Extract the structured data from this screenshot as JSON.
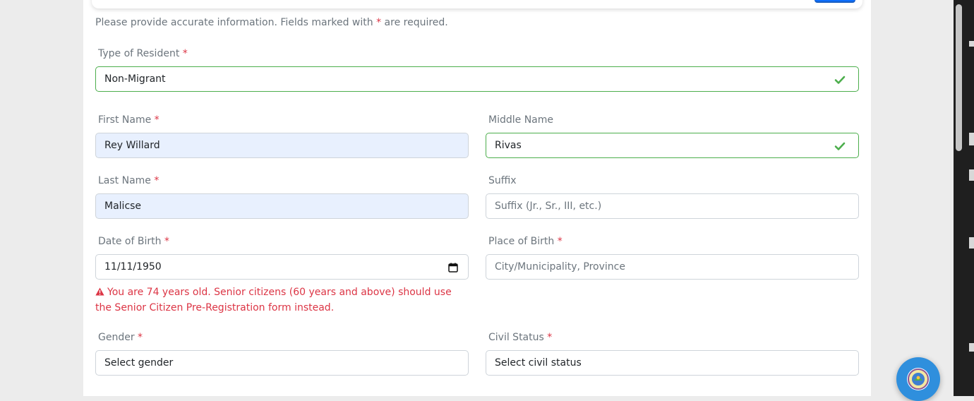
{
  "form": {
    "intro_prefix": "Please provide accurate information. Fields marked with",
    "intro_star": "*",
    "intro_suffix": "are required.",
    "required_mark": "*",
    "resident_type": {
      "label": "Type of Resident",
      "value": "Non-Migrant"
    },
    "first_name": {
      "label": "First Name",
      "value": "Rey Willard"
    },
    "middle_name": {
      "label": "Middle Name",
      "value": "Rivas"
    },
    "last_name": {
      "label": "Last Name",
      "value": "Malicse"
    },
    "suffix": {
      "label": "Suffix",
      "placeholder": "Suffix (Jr., Sr., III, etc.)"
    },
    "date_of_birth": {
      "label": "Date of Birth",
      "value": "11/11/1950"
    },
    "place_of_birth": {
      "label": "Place of Birth",
      "placeholder": "City/Municipality, Province"
    },
    "age_warning": "You are 74 years old. Senior citizens (60 years and above) should use the Senior Citizen Pre-Registration form instead.",
    "gender": {
      "label": "Gender",
      "value": "Select gender"
    },
    "civil_status": {
      "label": "Civil Status",
      "value": "Select civil status"
    }
  },
  "icons": {
    "valid": "check-icon",
    "warning": "warning-triangle-icon",
    "calendar": "calendar-icon",
    "assistant": "seal-logo-icon"
  },
  "colors": {
    "required": "#dc3545",
    "valid_border": "#4cae4c",
    "autofill_bg": "#e8f0fe",
    "fab": "#2f8fdd"
  }
}
